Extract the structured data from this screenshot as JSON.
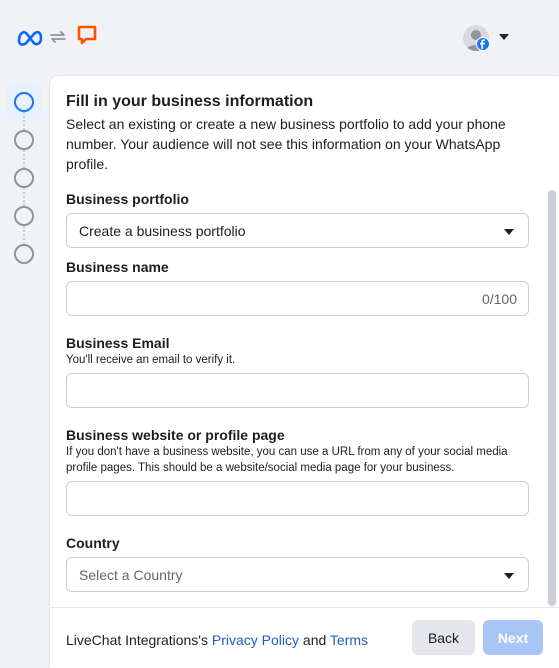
{
  "header": {
    "logos": [
      "meta-logo-icon",
      "swap-arrows-icon",
      "livechat-logo-icon"
    ],
    "account_icon": "profile-avatar-icon",
    "badge_icon": "facebook-badge-icon",
    "menu_icon": "caret-down-icon"
  },
  "steps": {
    "count": 5,
    "active_index": 0
  },
  "form": {
    "title": "Fill in your business information",
    "subtitle": "Select an existing or create a new business portfolio to add your phone number. Your audience will not see this information on your WhatsApp profile.",
    "business_portfolio": {
      "label": "Business portfolio",
      "value": "Create a business portfolio"
    },
    "business_name": {
      "label": "Business name",
      "value": "",
      "counter": "0/100"
    },
    "business_email": {
      "label": "Business Email",
      "help": "You'll receive an email to verify it.",
      "value": ""
    },
    "business_website": {
      "label": "Business website or profile page",
      "help": "If you don't have a business website, you can use a URL from any of your social media profile pages. This should be a website/social media page for your business.",
      "value": ""
    },
    "country": {
      "label": "Country",
      "placeholder": "Select a Country"
    }
  },
  "footer": {
    "prefix": "LiveChat Integrations's ",
    "privacy_link": "Privacy Policy",
    "and": " and ",
    "terms_link": "Terms",
    "back_label": "Back",
    "next_label": "Next"
  },
  "colors": {
    "accent": "#1877f2",
    "link": "#1f5fbf",
    "next_disabled": "#a8c5f5",
    "livechat_orange": "#ff5100"
  }
}
